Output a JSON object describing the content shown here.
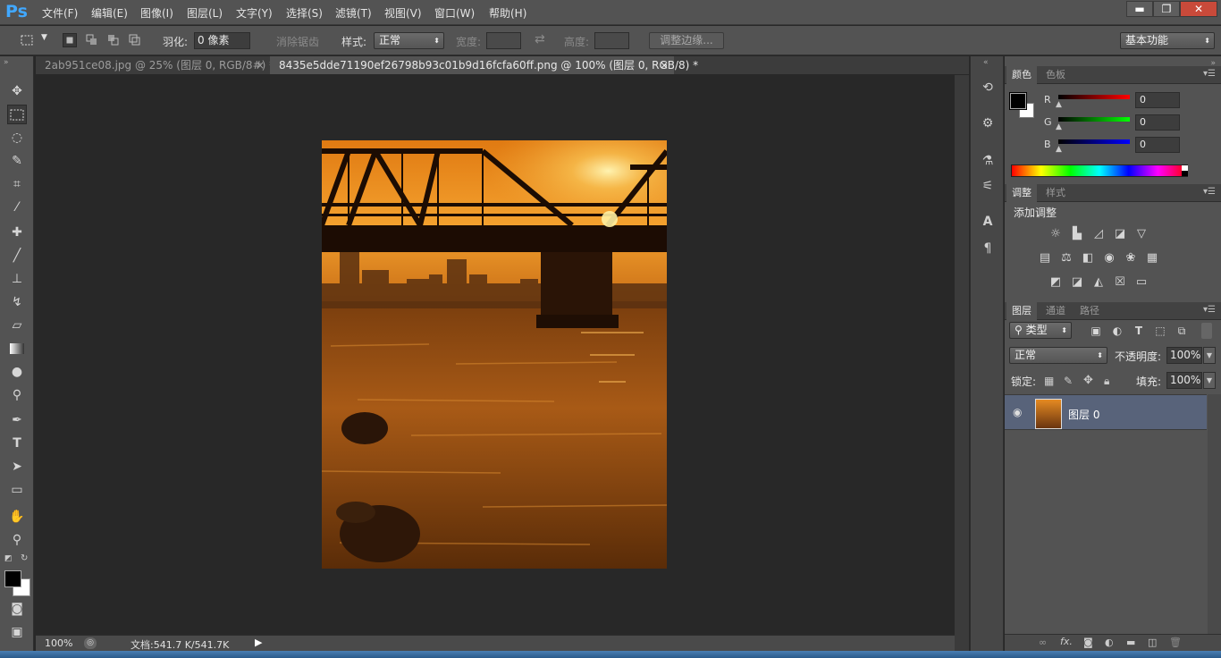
{
  "app": {
    "logo": "Ps"
  },
  "menu": [
    "文件(F)",
    "编辑(E)",
    "图像(I)",
    "图层(L)",
    "文字(Y)",
    "选择(S)",
    "滤镜(T)",
    "视图(V)",
    "窗口(W)",
    "帮助(H)"
  ],
  "window_controls": {
    "minimize": "▬",
    "restore": "❐",
    "close": "✕"
  },
  "options": {
    "feather_label": "羽化:",
    "feather_value": "0 像素",
    "antialias_label": "消除锯齿",
    "style_label": "样式:",
    "style_value": "正常",
    "width_label": "宽度:",
    "height_label": "高度:",
    "refine_edge": "调整边缘...",
    "workspace": "基本功能"
  },
  "tabs": [
    {
      "label": "2ab951ce08.jpg @ 25% (图层 0, RGB/8#) *",
      "close": "×",
      "active": false
    },
    {
      "label": "8435e5dde71190ef26798b93c01b9d16fcfa60ff.png @ 100% (图层 0, RGB/8) *",
      "close": "×",
      "active": true
    }
  ],
  "status": {
    "zoom": "100%",
    "doc_info": "文档:541.7 K/541.7K"
  },
  "color_panel": {
    "tabs": [
      "颜色",
      "色板"
    ],
    "channels": [
      {
        "label": "R",
        "value": "0",
        "color": "#ff0000"
      },
      {
        "label": "G",
        "value": "0",
        "color": "#00ff00"
      },
      {
        "label": "B",
        "value": "0",
        "color": "#0000ff"
      }
    ]
  },
  "adjust_panel": {
    "tabs": [
      "调整",
      "样式"
    ],
    "title": "添加调整"
  },
  "layers_panel": {
    "tabs": [
      "图层",
      "通道",
      "路径"
    ],
    "filter_kind": "类型",
    "blend_mode": "正常",
    "opacity_label": "不透明度:",
    "opacity_value": "100%",
    "lock_label": "锁定:",
    "fill_label": "填充:",
    "fill_value": "100%",
    "layers": [
      {
        "name": "图层 0",
        "visible": true
      }
    ]
  },
  "colors": {
    "accent": "#41a8ff",
    "layer_selected": "#58637a",
    "foreground": "#000000",
    "background": "#ffffff"
  }
}
